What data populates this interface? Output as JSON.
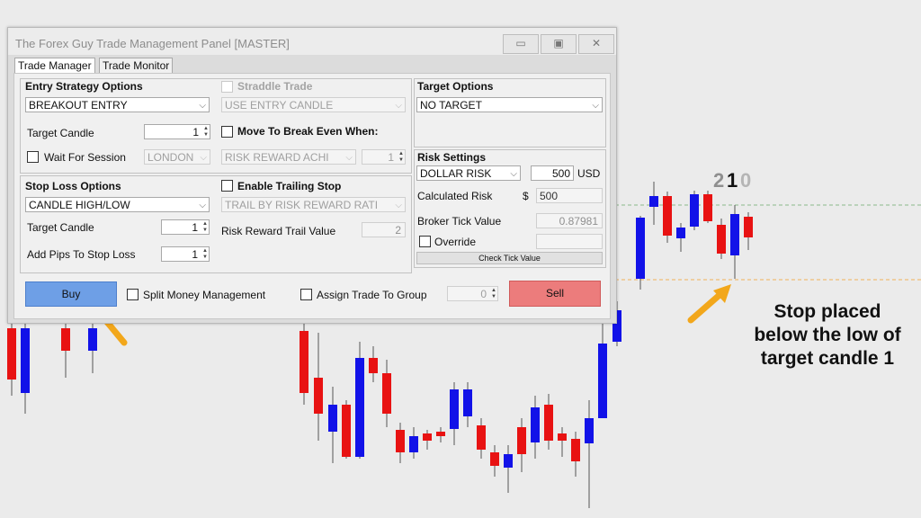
{
  "window": {
    "title": "The Forex Guy Trade Management Panel [MASTER]",
    "controls": [
      "▭",
      "▣",
      "✕"
    ],
    "tabs": [
      "Trade Manager",
      "Trade Monitor"
    ]
  },
  "entry": {
    "title": "Entry Strategy Options",
    "strategy": "BREAKOUT ENTRY",
    "target_candle_label": "Target Candle",
    "target_candle_value": "1",
    "wait_for_session_label": "Wait For Session",
    "session": "LONDON"
  },
  "straddle": {
    "label": "Straddle Trade",
    "candle": "USE ENTRY CANDLE"
  },
  "break_even": {
    "label": "Move To Break Even When:",
    "mode": "RISK REWARD ACHI",
    "value": "1"
  },
  "stop_loss": {
    "title": "Stop Loss Options",
    "mode": "CANDLE HIGH/LOW",
    "target_candle_label": "Target Candle",
    "target_candle_value": "1",
    "add_pips_label": "Add Pips To Stop Loss",
    "add_pips_value": "1"
  },
  "trailing": {
    "label": "Enable Trailing Stop",
    "mode": "TRAIL BY RISK REWARD RATI",
    "value_label": "Risk Reward Trail Value",
    "value": "2"
  },
  "target": {
    "title": "Target Options",
    "mode": "NO TARGET"
  },
  "risk": {
    "title": "Risk Settings",
    "mode": "DOLLAR RISK",
    "amount": "500",
    "currency": "USD",
    "calc_label": "Calculated Risk",
    "dollar_sign": "$",
    "calc_value": "500",
    "tick_label": "Broker Tick Value",
    "tick_value": "0.87981",
    "override_label": "Override",
    "check_tick_label": "Check Tick Value"
  },
  "bottom": {
    "buy_label": "Buy",
    "split_label": "Split Money Management",
    "assign_label": "Assign Trade To Group",
    "group_value": "0",
    "sell_label": "Sell"
  },
  "annotation": {
    "line1": "Stop placed",
    "line2": "below the low of",
    "line3": "target candle 1"
  },
  "candle_numbers": {
    "two": "2",
    "one": "1",
    "zero": "0"
  },
  "colors": {
    "bull": "#1212e8",
    "bear": "#e81212",
    "arrow": "#f2a71b",
    "buy_button": "#6e9fe6",
    "sell_button": "#ec7c7c"
  }
}
